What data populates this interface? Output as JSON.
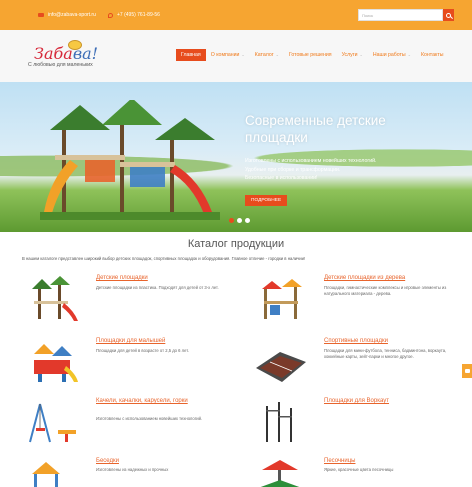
{
  "topbar": {
    "email": "info@zabava-sport.ru",
    "phone": "+7 (495) 761-89-56",
    "search_placeholder": "Поиск"
  },
  "logo": {
    "word_a": "Заба",
    "word_b": "ва!",
    "tagline": "С любовью для маленьких"
  },
  "nav": {
    "items": [
      {
        "label": "Главная",
        "active": true
      },
      {
        "label": "О компании",
        "dropdown": true
      },
      {
        "label": "Каталог",
        "dropdown": true
      },
      {
        "label": "Готовые решения"
      },
      {
        "label": "Услуги",
        "dropdown": true
      },
      {
        "label": "Наши работы",
        "dropdown": true
      },
      {
        "label": "Контакты"
      }
    ]
  },
  "hero": {
    "title": "Современные детские площадки",
    "text_1": "Изготовлены с использованием новейших технологий.",
    "text_2": "Удобные при сборке и трансформации.",
    "text_3": "Безопасные в использовании!",
    "button": "ПОДРОБНЕЕ",
    "active_slide": 1,
    "slides": 3
  },
  "catalog": {
    "title": "Каталог продукции",
    "intro": "В нашем каталоге представлен широкий выбор детских площадок, спортивных площадок и оборудования. Главное отличие - городки в наличии!",
    "items": [
      {
        "title": "Детские площадки",
        "desc": "Детские площадки из пластика. Подходят для детей от 3-х лет."
      },
      {
        "title": "Детские площадки из дерева",
        "desc": "Площадки, гимнастические комплексы и игровые элементы из натурального материала - дерева."
      },
      {
        "title": "Площадки для малышей",
        "desc": "Площадки для детей в возрасте от 2,5 до 6 лет."
      },
      {
        "title": "Спортивные площадки",
        "desc": "Площадки для мини-футбола, тенниса, бадминтона, воркаута, хоккейные карты, зейт-парки и многое другое."
      },
      {
        "title": "Качели, качалки, карусели, горки",
        "desc": "Изготовлены с использованием новейших технологий."
      },
      {
        "title": "Площадки для Воркаут",
        "desc": ""
      },
      {
        "title": "Беседки",
        "desc": "Изготовлены из надежных и прочных"
      },
      {
        "title": "Песочницы",
        "desc": "Яркие, красочные цвета песочницы"
      }
    ]
  },
  "colors": {
    "accent": "#e74c1d",
    "orange": "#f6a531",
    "link": "#e8642c"
  }
}
